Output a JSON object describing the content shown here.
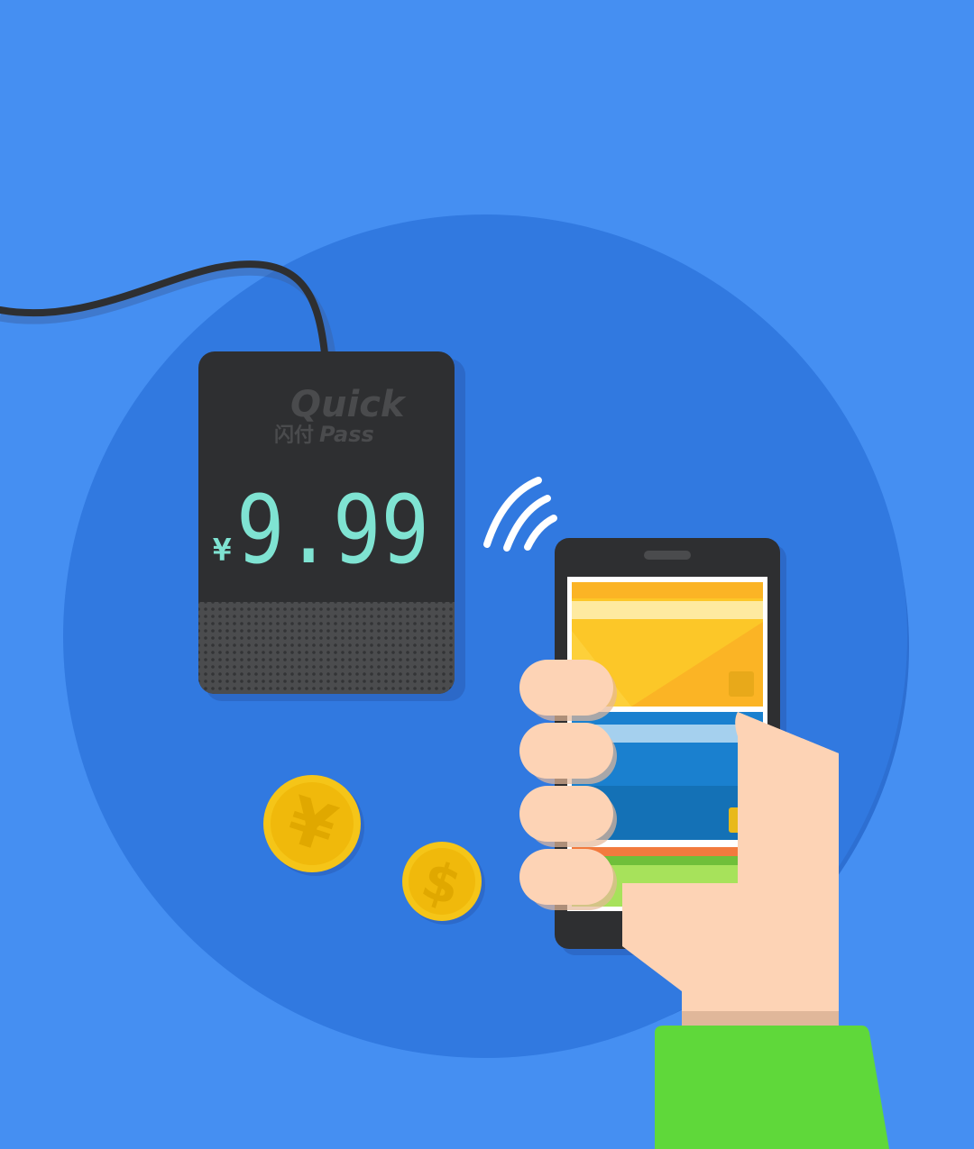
{
  "terminal": {
    "brand_top": "Quick",
    "brand_cn": "闪付",
    "brand_bottom": "Pass",
    "currency_symbol": "¥",
    "amount": "9.99"
  },
  "coins": {
    "yuan_symbol": "¥",
    "dollar_symbol": "$"
  },
  "colors": {
    "background": "#458ff2",
    "circle": "#2f78e0",
    "terminal_body": "#2e2f31",
    "display_digits": "#7fe3d2",
    "phone_body": "#2e2f31",
    "card_yellow": "#fbbf22",
    "card_blue": "#1a7fcf",
    "card_green": "#a6e05a",
    "skin": "#fdd3b5",
    "sleeve": "#5fd83a",
    "coin": "#f5c518"
  }
}
